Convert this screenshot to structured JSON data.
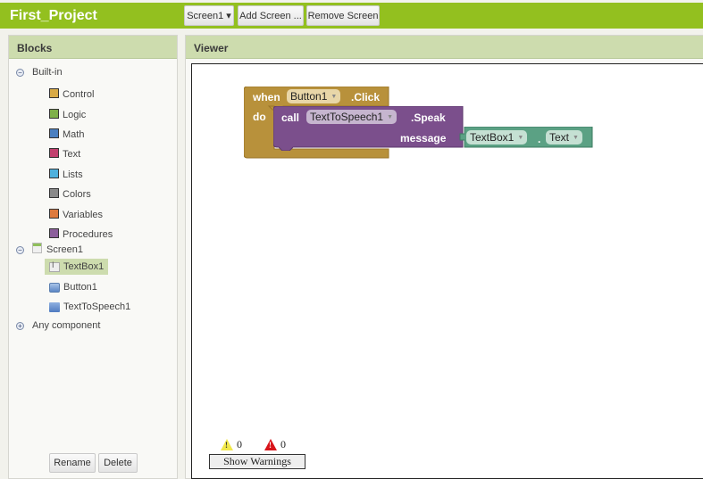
{
  "header": {
    "title": "First_Project",
    "screen_select": "Screen1 ▾",
    "add_screen": "Add Screen ...",
    "remove_screen": "Remove Screen"
  },
  "blocks_panel": {
    "title": "Blocks",
    "builtin": {
      "label": "Built-in",
      "items": [
        {
          "label": "Control",
          "color": "#d8aa46"
        },
        {
          "label": "Logic",
          "color": "#7fb04b"
        },
        {
          "label": "Math",
          "color": "#4a7fc1"
        },
        {
          "label": "Text",
          "color": "#c1406e"
        },
        {
          "label": "Lists",
          "color": "#4fb1dd"
        },
        {
          "label": "Colors",
          "color": "#8a8a8a"
        },
        {
          "label": "Variables",
          "color": "#de7a3e"
        },
        {
          "label": "Procedures",
          "color": "#8c5f9c"
        }
      ]
    },
    "screen": {
      "label": "Screen1",
      "components": [
        {
          "label": "TextBox1",
          "icon": "textbox-icon",
          "selected": true
        },
        {
          "label": "Button1",
          "icon": "button-icon",
          "selected": false
        },
        {
          "label": "TextToSpeech1",
          "icon": "speech-bubble-icon",
          "selected": false
        }
      ]
    },
    "any_component": "Any component",
    "rename": "Rename",
    "delete": "Delete"
  },
  "viewer": {
    "title": "Viewer",
    "event_block": {
      "when": "when",
      "component": "Button1",
      "event": ".Click",
      "do": "do",
      "color": "#b8913b"
    },
    "call_block": {
      "call": "call",
      "component": "TextToSpeech1",
      "method": ".Speak",
      "arg_label": "message",
      "color": "#7b4f8c"
    },
    "getter_block": {
      "component": "TextBox1",
      "dot": ".",
      "property": "Text",
      "color": "#5ba184"
    },
    "warnings_count": "0",
    "errors_count": "0",
    "show_warnings": "Show Warnings"
  }
}
